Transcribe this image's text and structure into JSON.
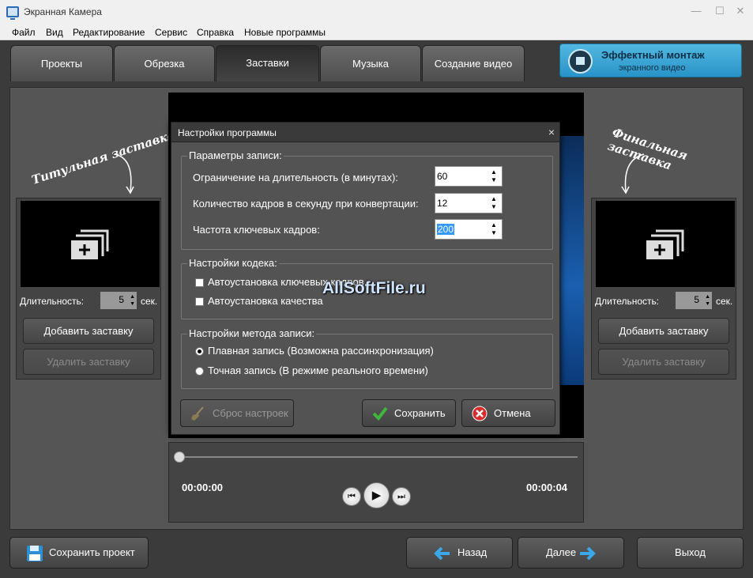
{
  "window": {
    "title": "Экранная Камера"
  },
  "menu": [
    "Файл",
    "Вид",
    "Редактирование",
    "Сервис",
    "Справка",
    "Новые программы"
  ],
  "tabs": [
    {
      "label": "Проекты",
      "active": false
    },
    {
      "label": "Обрезка",
      "active": false
    },
    {
      "label": "Заставки",
      "active": true
    },
    {
      "label": "Музыка",
      "active": false
    },
    {
      "label": "Создание видео",
      "active": false
    }
  ],
  "promo": {
    "title": "Эффектный монтаж",
    "subtitle": "экранного видео"
  },
  "left_panel": {
    "heading": "Титульная заставка",
    "duration_label": "Длительность:",
    "duration_value": "5",
    "unit": "сек.",
    "add_button": "Добавить заставку",
    "remove_button": "Удалить заставку"
  },
  "right_panel": {
    "heading": "Финальная заставка",
    "duration_label": "Длительность:",
    "duration_value": "5",
    "unit": "сек.",
    "add_button": "Добавить заставку",
    "remove_button": "Удалить заставку"
  },
  "player": {
    "current_time": "00:00:00",
    "total_time": "00:00:04"
  },
  "dialog": {
    "title": "Настройки программы",
    "close": "×",
    "record_params": {
      "legend": "Параметры записи:",
      "fields": [
        {
          "label": "Ограничение на длительность (в минутах):",
          "value": "60"
        },
        {
          "label": "Количество кадров в секунду при конвертации:",
          "value": "12"
        },
        {
          "label": "Частота ключевых кадров:",
          "value": "200"
        }
      ]
    },
    "codec": {
      "legend": "Настройки кодека:",
      "options": [
        {
          "label": "Автоустановка ключевых кадров",
          "checked": false
        },
        {
          "label": "Автоустановка качества",
          "checked": false
        }
      ]
    },
    "method": {
      "legend": "Настройки метода записи:",
      "options": [
        {
          "label": "Плавная запись (Возможна рассинхронизация)",
          "selected": true
        },
        {
          "label": "Точная запись (В режиме реального времени)",
          "selected": false
        }
      ]
    },
    "reset_button": "Сброс настроек",
    "save_button": "Сохранить",
    "cancel_button": "Отмена",
    "watermark": "AllSoftFile.ru"
  },
  "bottom": {
    "save_project": "Сохранить проект",
    "back": "Назад",
    "next": "Далее",
    "exit": "Выход"
  },
  "colors": {
    "accent": "#2a93c8",
    "ok": "#3db83d",
    "cancel": "#d62b2b"
  }
}
